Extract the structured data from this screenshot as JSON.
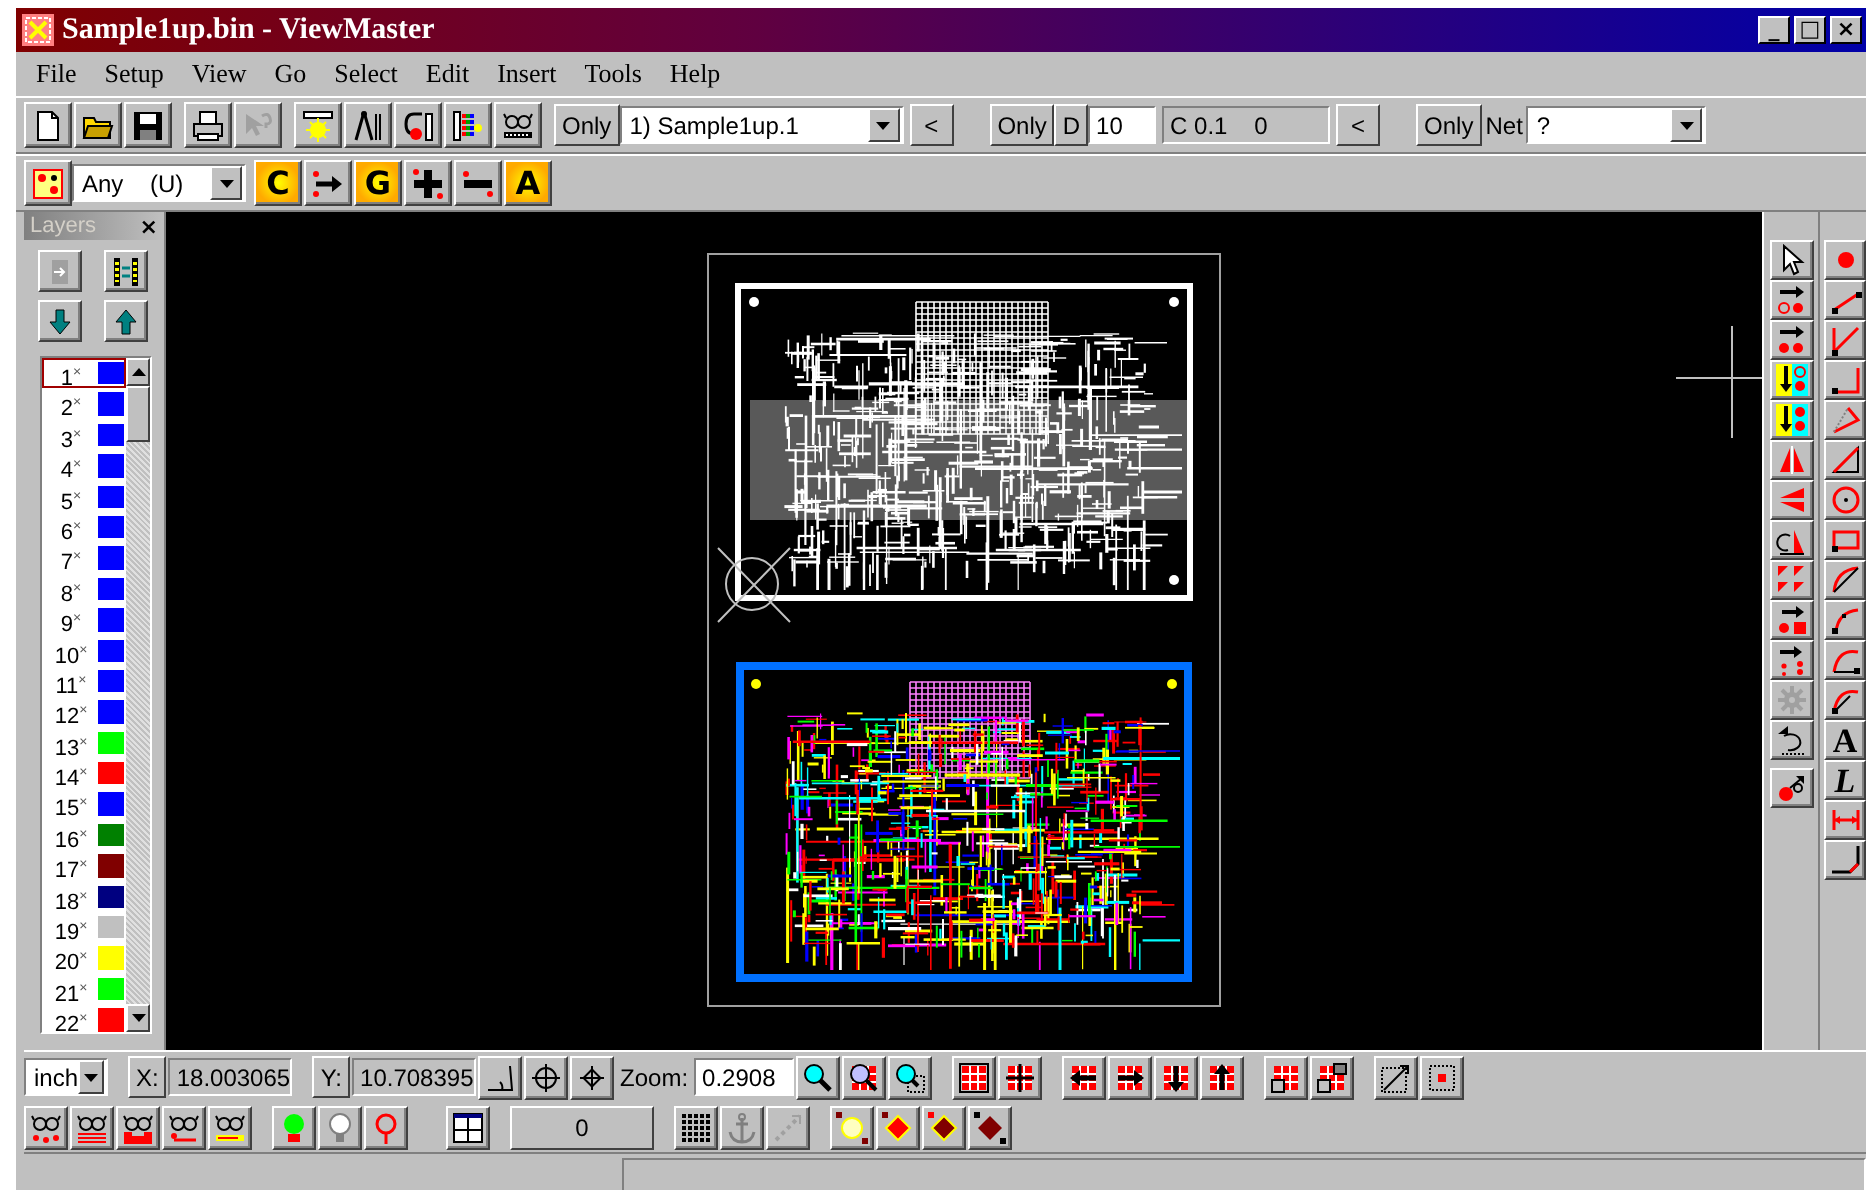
{
  "window": {
    "title": "Sample1up.bin - ViewMaster",
    "controls": [
      "_",
      "□",
      "×"
    ]
  },
  "menu": [
    "File",
    "Setup",
    "View",
    "Go",
    "Select",
    "Edit",
    "Insert",
    "Tools",
    "Help"
  ],
  "design_bar": {
    "only_design": "Only",
    "design_combo": "1) Sample1up.1",
    "design_back": "<",
    "only_dcode": "Only",
    "dcode_label": "D",
    "dcode_value": "10",
    "dcode_info": "C 0.1    0",
    "dcode_back": "<",
    "only_net": "Only",
    "net_label": "Net",
    "net_combo": "?"
  },
  "filter_bar": {
    "combo": "Any    (U)",
    "tools": [
      {
        "kind": "text",
        "label": "C"
      },
      {
        "kind": "icon"
      },
      {
        "kind": "text",
        "label": "G"
      },
      {
        "kind": "icon"
      },
      {
        "kind": "icon"
      },
      {
        "kind": "text",
        "label": "A"
      }
    ]
  },
  "layers": {
    "title": "Layers",
    "close": "×",
    "items": [
      {
        "label": "1$^{×}$",
        "color": "#0000ff",
        "selected": true
      },
      {
        "label": "2$^{×}$",
        "color": "#0000ff",
        "selected": false
      },
      {
        "label": "3$^{×}$",
        "color": "#0000ff",
        "selected": false
      },
      {
        "label": "4$^{×}$",
        "color": "#0000ff",
        "selected": false
      },
      {
        "label": "5$^{×}$",
        "color": "#0000ff",
        "selected": false
      },
      {
        "label": "6$^{×}$",
        "color": "#0000ff",
        "selected": false
      },
      {
        "label": "7$^{×}$",
        "color": "#0000ff",
        "selected": false
      },
      {
        "label": "8$^{×}$",
        "color": "#0000ff",
        "selected": false
      },
      {
        "label": "9$^{×}$",
        "color": "#0000ff",
        "selected": false
      },
      {
        "label": "10$^{×}$",
        "color": "#0000ff",
        "selected": false
      },
      {
        "label": "11$^{×}$",
        "color": "#0000ff",
        "selected": false
      },
      {
        "label": "12$^{×}$",
        "color": "#0000ff",
        "selected": false
      },
      {
        "label": "13$^{×}$",
        "color": "#00ff00",
        "selected": false
      },
      {
        "label": "14$^{×}$",
        "color": "#ff0000",
        "selected": false
      },
      {
        "label": "15$^{×}$",
        "color": "#0000ff",
        "selected": false
      },
      {
        "label": "16$^{×}$",
        "color": "#008000",
        "selected": false
      },
      {
        "label": "17$^{×}$",
        "color": "#800000",
        "selected": false
      },
      {
        "label": "18$^{×}$",
        "color": "#000080",
        "selected": false
      },
      {
        "label": "19$^{×}$",
        "color": "#c0c0c0",
        "selected": false
      },
      {
        "label": "20$^{×}$",
        "color": "#ffff00",
        "selected": false
      },
      {
        "label": "21$^{×}$",
        "color": "#00ff00",
        "selected": false
      },
      {
        "label": "22$^{×}$",
        "color": "#ff0000",
        "selected": false
      }
    ]
  },
  "draw_tools": [
    {
      "kind": "icon"
    },
    {
      "kind": "icon"
    },
    {
      "kind": "icon"
    },
    {
      "kind": "icon"
    },
    {
      "kind": "icon"
    },
    {
      "kind": "icon"
    },
    {
      "kind": "icon"
    },
    {
      "kind": "icon"
    },
    {
      "kind": "icon"
    },
    {
      "kind": "icon"
    },
    {
      "kind": "icon"
    },
    {
      "kind": "icon"
    },
    {
      "kind": "text",
      "label": "A"
    },
    {
      "kind": "italic",
      "label": "L"
    },
    {
      "kind": "icon"
    },
    {
      "kind": "icon"
    }
  ],
  "coord_bar": {
    "units_combo": "inch",
    "x_label": "X:",
    "x_value": "18.003065",
    "y_label": "Y:",
    "y_value": "10.708395",
    "zoom_label": "Zoom:",
    "zoom_value": "0.2908"
  },
  "view_bar": {
    "count_button": "0"
  }
}
